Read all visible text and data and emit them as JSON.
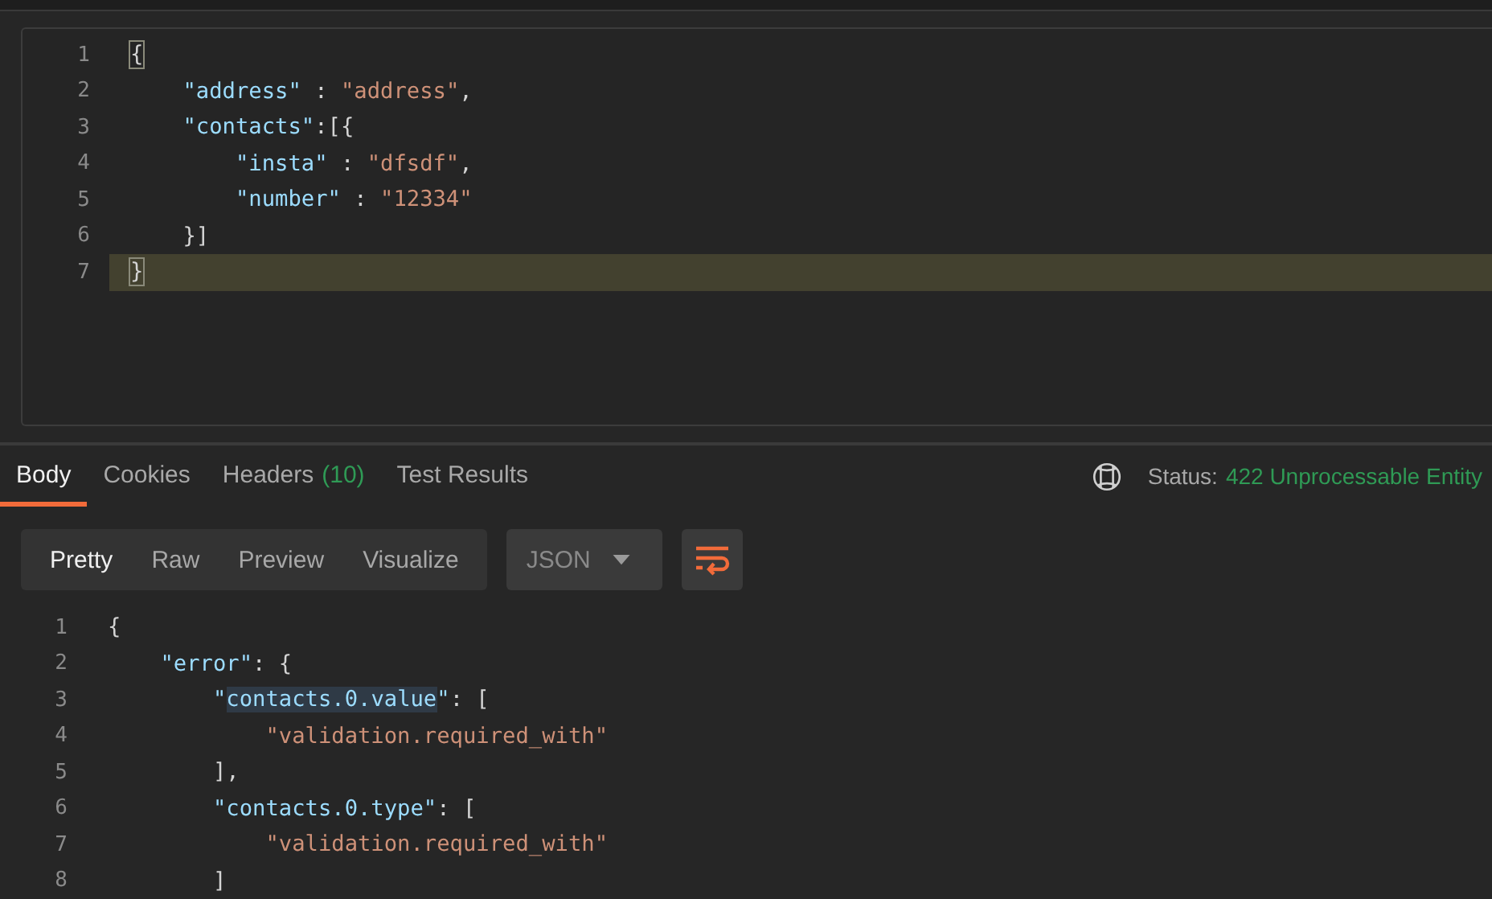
{
  "request_editor": {
    "lines": [
      {
        "number": "1",
        "current": false,
        "tokens": [
          {
            "kind": "bracket-match",
            "text": "{"
          }
        ]
      },
      {
        "number": "2",
        "current": false,
        "tokens": [
          {
            "kind": "key",
            "text": "    \"address\""
          },
          {
            "kind": "punct",
            "text": " : "
          },
          {
            "kind": "string",
            "text": "\"address\""
          },
          {
            "kind": "punct",
            "text": ","
          }
        ]
      },
      {
        "number": "3",
        "current": false,
        "tokens": [
          {
            "kind": "key",
            "text": "    \"contacts\""
          },
          {
            "kind": "punct",
            "text": ":[{"
          }
        ]
      },
      {
        "number": "4",
        "current": false,
        "tokens": [
          {
            "kind": "key",
            "text": "        \"insta\""
          },
          {
            "kind": "punct",
            "text": " : "
          },
          {
            "kind": "string",
            "text": "\"dfsdf\""
          },
          {
            "kind": "punct",
            "text": ","
          }
        ]
      },
      {
        "number": "5",
        "current": false,
        "tokens": [
          {
            "kind": "key",
            "text": "        \"number\""
          },
          {
            "kind": "punct",
            "text": " : "
          },
          {
            "kind": "string",
            "text": "\"12334\""
          }
        ]
      },
      {
        "number": "6",
        "current": false,
        "tokens": [
          {
            "kind": "punct",
            "text": "    }]"
          }
        ]
      },
      {
        "number": "7",
        "current": true,
        "tokens": [
          {
            "kind": "bracket-match",
            "text": "}"
          }
        ]
      }
    ]
  },
  "response_tabs": [
    {
      "label": "Body",
      "selected": true
    },
    {
      "label": "Cookies",
      "selected": false
    },
    {
      "label": "Headers",
      "count": "(10)",
      "selected": false
    },
    {
      "label": "Test Results",
      "selected": false
    }
  ],
  "status": {
    "label": "Status:",
    "value": "422 Unprocessable Entity"
  },
  "view_modes": [
    {
      "label": "Pretty",
      "selected": true
    },
    {
      "label": "Raw",
      "selected": false
    },
    {
      "label": "Preview",
      "selected": false
    },
    {
      "label": "Visualize",
      "selected": false
    }
  ],
  "format_dropdown": {
    "value": "JSON"
  },
  "wrap_lines": {
    "on": true
  },
  "response_body": {
    "lines": [
      {
        "number": "1",
        "tokens": [
          {
            "kind": "punct",
            "text": "{"
          }
        ]
      },
      {
        "number": "2",
        "tokens": [
          {
            "kind": "key",
            "text": "    \"error\""
          },
          {
            "kind": "punct",
            "text": ": {"
          }
        ]
      },
      {
        "number": "3",
        "tokens": [
          {
            "kind": "key",
            "text": "        \""
          },
          {
            "kind": "key-selected",
            "text": "contacts.0.value"
          },
          {
            "kind": "key",
            "text": "\""
          },
          {
            "kind": "punct",
            "text": ": ["
          }
        ]
      },
      {
        "number": "4",
        "tokens": [
          {
            "kind": "string",
            "text": "            \"validation.required_with\""
          }
        ]
      },
      {
        "number": "5",
        "tokens": [
          {
            "kind": "punct",
            "text": "        ],"
          }
        ]
      },
      {
        "number": "6",
        "tokens": [
          {
            "kind": "key",
            "text": "        \"contacts.0.type\""
          },
          {
            "kind": "punct",
            "text": ": ["
          }
        ]
      },
      {
        "number": "7",
        "tokens": [
          {
            "kind": "string",
            "text": "            \"validation.required_with\""
          }
        ]
      },
      {
        "number": "8",
        "tokens": [
          {
            "kind": "punct",
            "text": "        ]"
          }
        ]
      }
    ]
  }
}
